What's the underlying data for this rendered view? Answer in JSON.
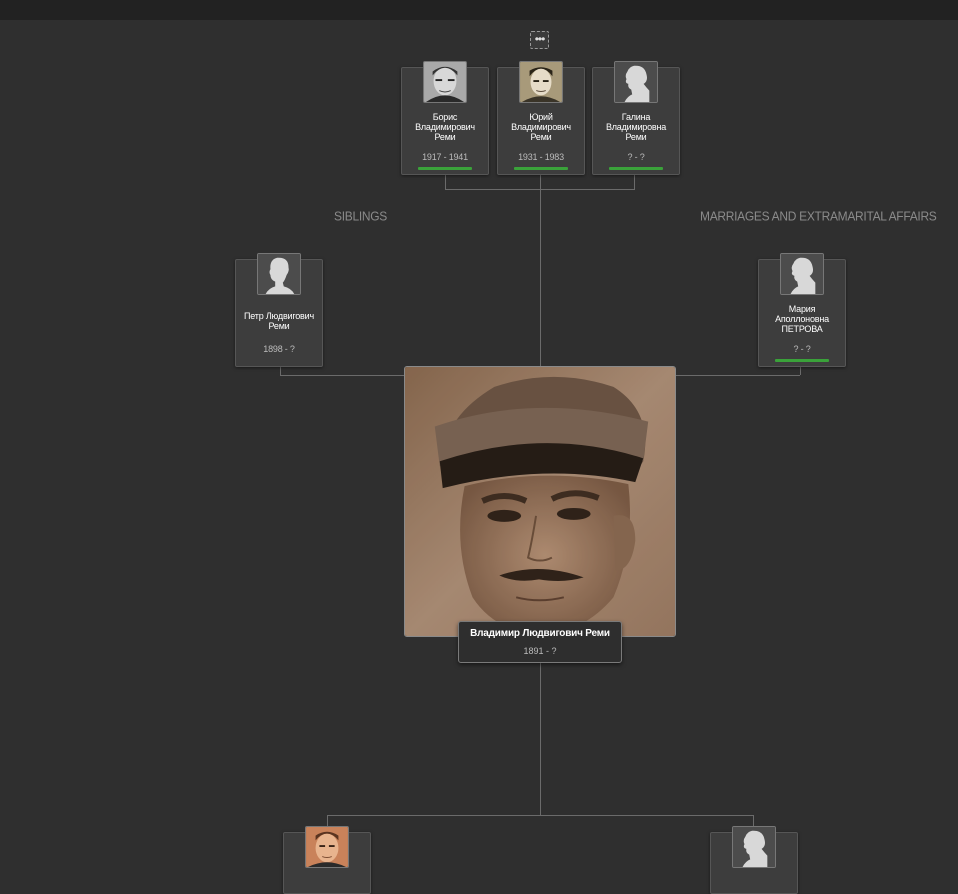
{
  "sections": {
    "siblings": "SIBLINGS",
    "marriages": "MARRIAGES AND EXTRAMARITAL AFFAIRS"
  },
  "more_button": {
    "label": "•••"
  },
  "children": [
    {
      "name": "Борис Владимирович Реми",
      "dates": "1917 - 1941",
      "photo": "photo-male-1",
      "status_color": "#3aa23a"
    },
    {
      "name": "Юрий Владимирович Реми",
      "dates": "1931 - 1983",
      "photo": "photo-male-2",
      "status_color": "#3aa23a"
    },
    {
      "name": "Галина Владимировна Реми",
      "dates": "? - ?",
      "photo": "female-silhouette-icon",
      "status_color": "#3aa23a"
    }
  ],
  "sibling": {
    "name": "Петр Людвигович Реми",
    "dates": "1898 - ?",
    "photo": "male-silhouette-icon"
  },
  "spouse": {
    "name": "Мария Аполлоновна ПЕТРОВА",
    "dates": "? - ?",
    "photo": "female-silhouette-icon",
    "status_color": "#3aa23a"
  },
  "main_person": {
    "name": "Владимир Людвигович Реми",
    "dates": "1891 - ?"
  },
  "parents": [
    {
      "photo": "photo-male-3"
    },
    {
      "photo": "female-silhouette-icon"
    }
  ]
}
